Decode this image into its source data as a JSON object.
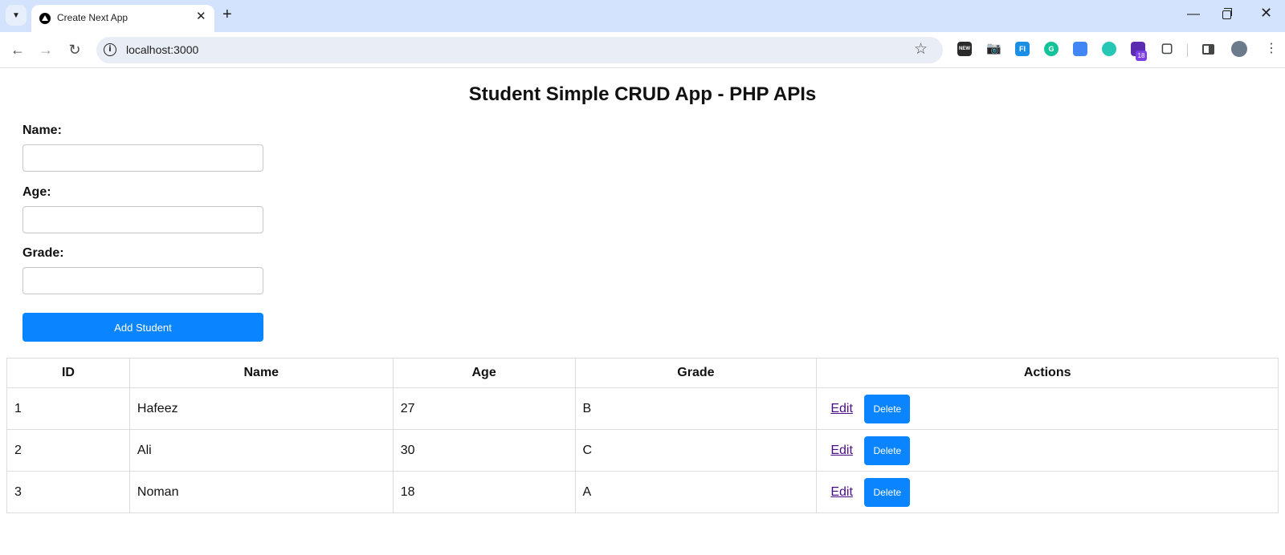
{
  "browser": {
    "tab_title": "Create Next App",
    "url": "localhost:3000",
    "extension_badge": "18",
    "extension_new_label": "NEW",
    "extension_fi_label": "FI"
  },
  "page": {
    "title": "Student Simple CRUD App - PHP APIs"
  },
  "form": {
    "name_label": "Name:",
    "name_value": "",
    "age_label": "Age:",
    "age_value": "",
    "grade_label": "Grade:",
    "grade_value": "",
    "submit_label": "Add Student"
  },
  "table": {
    "headers": [
      "ID",
      "Name",
      "Age",
      "Grade",
      "Actions"
    ],
    "rows": [
      {
        "id": "1",
        "name": "Hafeez",
        "age": "27",
        "grade": "B"
      },
      {
        "id": "2",
        "name": "Ali",
        "age": "30",
        "grade": "C"
      },
      {
        "id": "3",
        "name": "Noman",
        "age": "18",
        "grade": "A"
      }
    ],
    "edit_label": "Edit",
    "delete_label": "Delete"
  },
  "colors": {
    "primary_button": "#0a84ff",
    "edit_link": "#4b0c8a",
    "tabstrip": "#d3e3fd"
  }
}
